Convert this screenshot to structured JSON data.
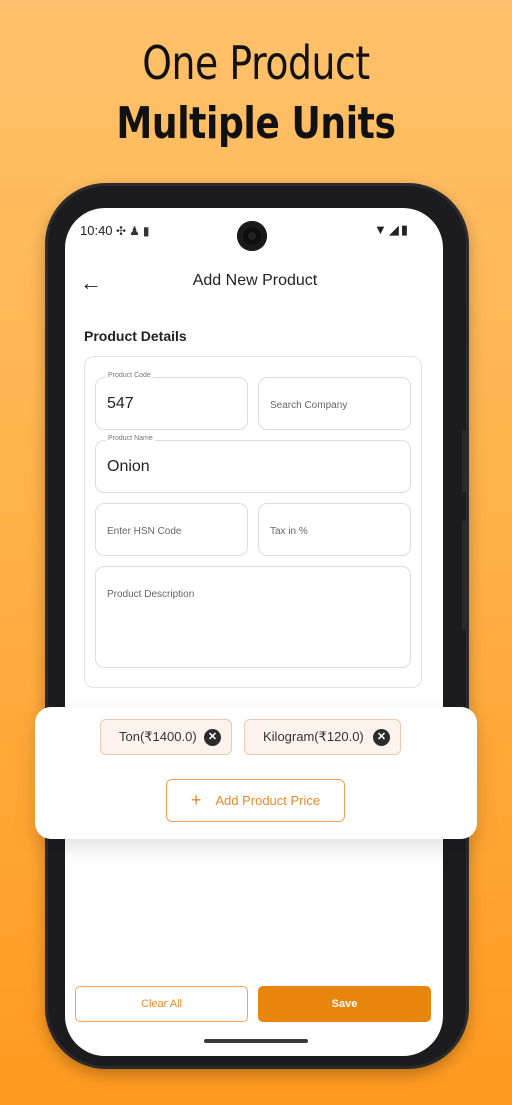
{
  "promo": {
    "headline_line1": "One Product",
    "headline_line2": "Multiple Units"
  },
  "status_bar": {
    "time": "10:40",
    "left_icons": [
      "fan-icon",
      "person-icon",
      "sim-icon"
    ],
    "right_icons": [
      "wifi-icon",
      "signal-icon",
      "battery-icon"
    ]
  },
  "app_bar": {
    "title": "Add New Product",
    "back_icon": "arrow-left-icon"
  },
  "product_details": {
    "section_title": "Product Details",
    "product_code": {
      "label": "Product Code",
      "value": "547"
    },
    "search_company": {
      "placeholder": "Search Company"
    },
    "product_name": {
      "label": "Product Name",
      "value": "Onion"
    },
    "hsn_code": {
      "placeholder": "Enter HSN Code"
    },
    "tax": {
      "placeholder": "Tax in %"
    },
    "description": {
      "placeholder": "Product Description"
    }
  },
  "prices": {
    "chips": [
      {
        "label": "Ton(₹1400.0)"
      },
      {
        "label": "Kilogram(₹120.0)"
      }
    ],
    "add_button_label": "Add Product Price"
  },
  "footer": {
    "clear_label": "Clear All",
    "save_label": "Save"
  },
  "colors": {
    "accent": "#E8850C",
    "background_top": "#FFC16B",
    "background_bottom": "#FF9A1F"
  }
}
